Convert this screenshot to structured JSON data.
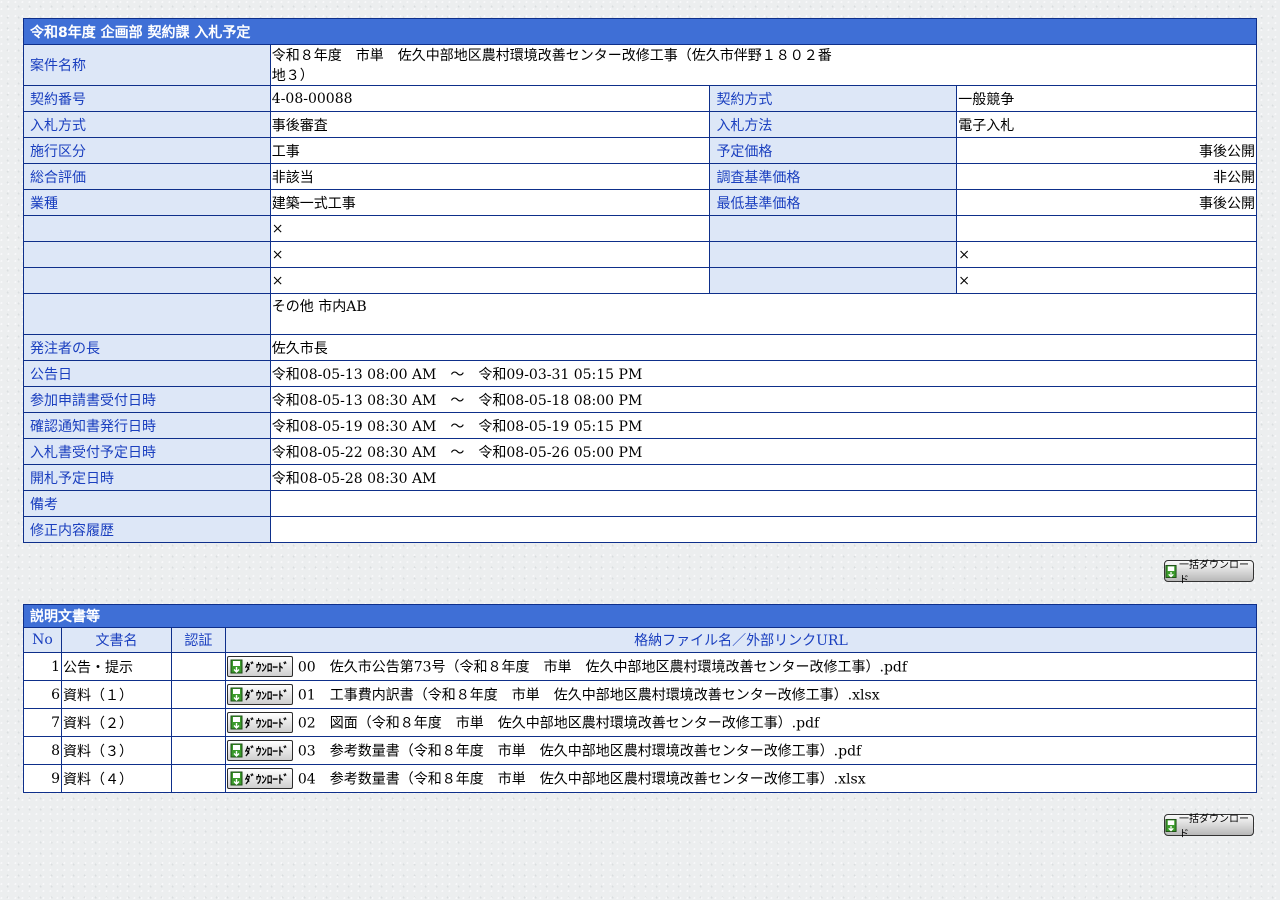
{
  "info": {
    "header": "令和8年度 企画部 契約課 入札予定",
    "project_name_label": "案件名称",
    "project_name": "令和８年度　市単　佐久中部地区農村環境改善センター改修工事（佐久市伴野１８０２番",
    "project_name_line2": "地３）",
    "rows": [
      {
        "l1": "契約番号",
        "v1": "4-08-00088",
        "l2": "契約方式",
        "v2": "一般競争"
      },
      {
        "l1": "入札方式",
        "v1": "事後審査",
        "l2": "入札方法",
        "v2": "電子入札"
      },
      {
        "l1": "施行区分",
        "v1": "工事",
        "l2": "予定価格",
        "v2": "事後公開"
      },
      {
        "l1": "総合評価",
        "v1": "非該当",
        "l2": "調査基準価格",
        "v2": "非公開"
      },
      {
        "l1": "業種",
        "v1": "建築一式工事",
        "l2": "最低基準価格",
        "v2": "事後公開"
      },
      {
        "l1": "",
        "v1": "×",
        "l2": "",
        "v2": ""
      },
      {
        "l1": "",
        "v1": "×",
        "l2": "",
        "v2": "×"
      },
      {
        "l1": "",
        "v1": "×",
        "l2": "",
        "v2": "×"
      }
    ],
    "region_value": "その他 市内AB",
    "full_rows": [
      {
        "label": "発注者の長",
        "value": "佐久市長"
      },
      {
        "label": "公告日",
        "value": "令和08-05-13 08:00 AM　～　令和09-03-31 05:15 PM"
      },
      {
        "label": "参加申請書受付日時",
        "value": "令和08-05-13 08:30 AM　～　令和08-05-18 08:00 PM"
      },
      {
        "label": "確認通知書発行日時",
        "value": "令和08-05-19 08:30 AM　～　令和08-05-19 05:15 PM"
      },
      {
        "label": "入札書受付予定日時",
        "value": "令和08-05-22 08:30 AM　～　令和08-05-26 05:00 PM"
      },
      {
        "label": "開札予定日時",
        "value": "令和08-05-28 08:30 AM"
      },
      {
        "label": "備考",
        "value": ""
      },
      {
        "label": "修正内容履歴",
        "value": ""
      }
    ]
  },
  "bulk_download_label": "一括ダウンロード",
  "docs": {
    "header": "説明文書等",
    "columns": [
      "No",
      "文書名",
      "認証",
      "格納ファイル名／外部リンクURL"
    ],
    "download_label": "ﾀﾞｳﾝﾛｰﾄﾞ",
    "items": [
      {
        "no": "1",
        "name": "公告・提示",
        "auth": "",
        "file": "00　佐久市公告第73号（令和８年度　市単　佐久中部地区農村環境改善センター改修工事）.pdf"
      },
      {
        "no": "6",
        "name": "資料（１）",
        "auth": "",
        "file": "01　工事費内訳書（令和８年度　市単　佐久中部地区農村環境改善センター改修工事）.xlsx"
      },
      {
        "no": "7",
        "name": "資料（２）",
        "auth": "",
        "file": "02　図面（令和８年度　市単　佐久中部地区農村環境改善センター改修工事）.pdf"
      },
      {
        "no": "8",
        "name": "資料（３）",
        "auth": "",
        "file": "03　参考数量書（令和８年度　市単　佐久中部地区農村環境改善センター改修工事）.pdf"
      },
      {
        "no": "9",
        "name": "資料（４）",
        "auth": "",
        "file": "04　参考数量書（令和８年度　市単　佐久中部地区農村環境改善センター改修工事）.xlsx"
      }
    ]
  },
  "colors": {
    "header": "#3f6fd6",
    "label_bg": "#dde7f7",
    "label_text": "#1a3fbf",
    "border": "#0e2f8a"
  }
}
